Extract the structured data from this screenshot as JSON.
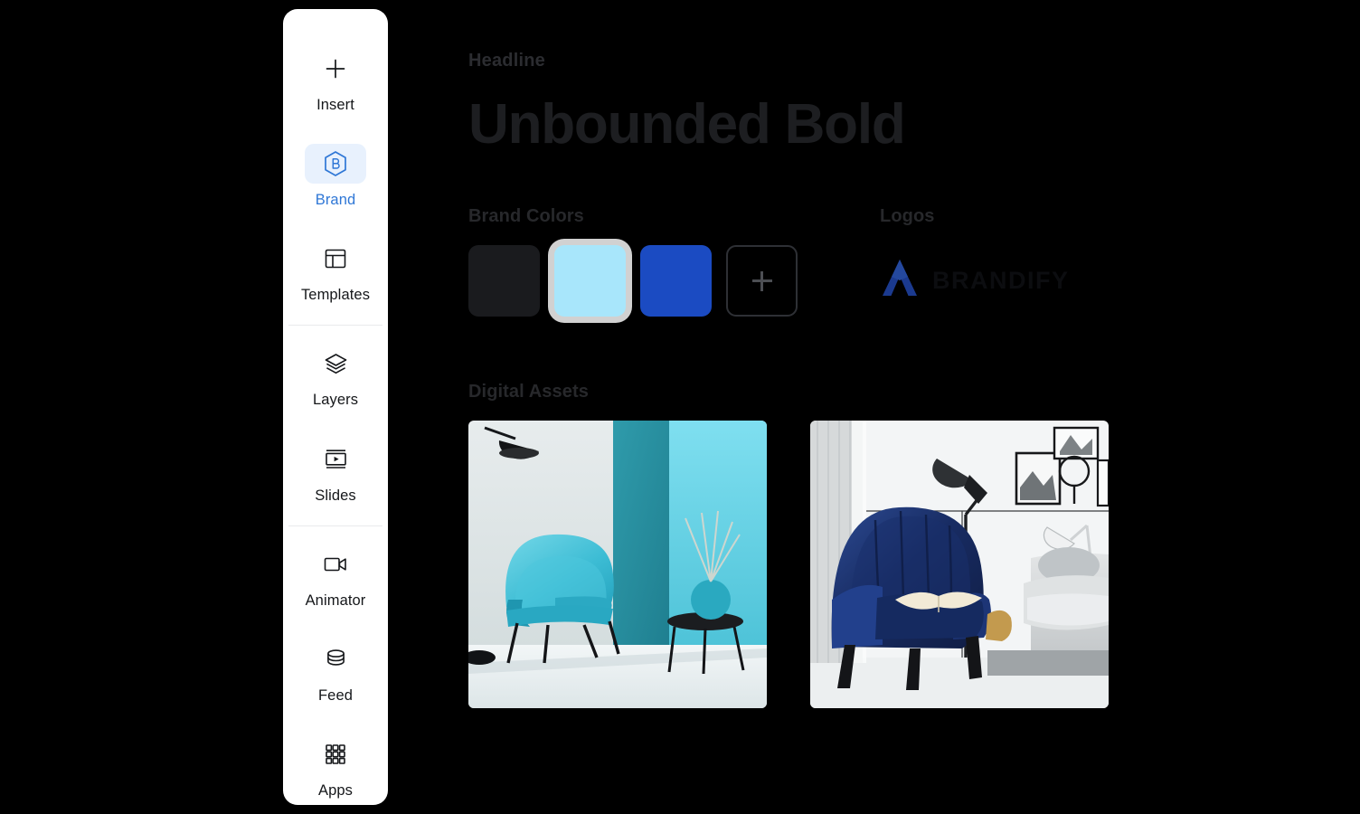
{
  "sidebar": {
    "items": [
      {
        "label": "Insert",
        "icon": "plus-icon",
        "active": false
      },
      {
        "label": "Brand",
        "icon": "brand-hex-icon",
        "active": true
      },
      {
        "label": "Templates",
        "icon": "layout-icon",
        "active": false
      },
      {
        "label": "Layers",
        "icon": "layers-icon",
        "active": false
      },
      {
        "label": "Slides",
        "icon": "slides-icon",
        "active": false
      },
      {
        "label": "Animator",
        "icon": "video-icon",
        "active": false
      },
      {
        "label": "Feed",
        "icon": "database-icon",
        "active": false
      },
      {
        "label": "Apps",
        "icon": "grid-apps-icon",
        "active": false
      }
    ]
  },
  "main": {
    "eyebrow": "Headline",
    "headline": "Unbounded Bold",
    "colors": {
      "title": "Brand Colors",
      "swatches": [
        {
          "name": "ink",
          "hex": "#1A1B1E",
          "ring": false
        },
        {
          "name": "sky",
          "hex": "#A8E6FB",
          "ring": true
        },
        {
          "name": "brandblue",
          "hex": "#1B4BC2",
          "ring": false
        }
      ],
      "add_label": "+"
    },
    "logos": {
      "title": "Logos",
      "wordmark": "BRANDIFY",
      "mark_color": "#1B3A8F"
    },
    "assets": {
      "title": "Digital Assets",
      "items": [
        {
          "name": "teal-armchair-interior",
          "alt": "Teal armchair in turquoise studio room with wall lamp and side table"
        },
        {
          "name": "navy-wingback-interior",
          "alt": "Navy velvet wingback armchair in bright room with floor lamp and framed art"
        }
      ]
    }
  }
}
